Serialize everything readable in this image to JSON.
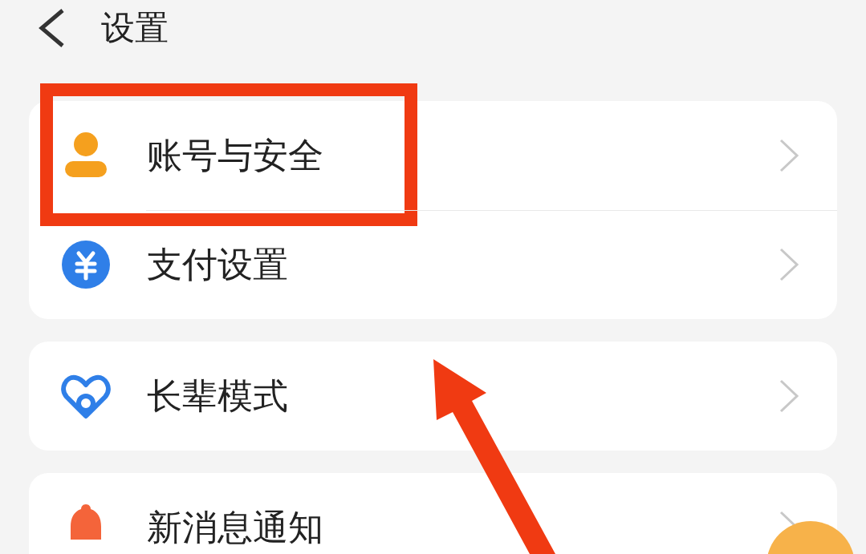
{
  "header": {
    "title": "设置"
  },
  "groups": [
    {
      "items": [
        {
          "kind": "person",
          "label": "账号与安全",
          "highlighted": true
        },
        {
          "kind": "yuan",
          "label": "支付设置",
          "highlighted": false
        }
      ]
    },
    {
      "items": [
        {
          "kind": "heart",
          "label": "长辈模式",
          "highlighted": false
        }
      ]
    },
    {
      "items": [
        {
          "kind": "bell",
          "label": "新消息通知",
          "highlighted": false
        }
      ]
    }
  ]
}
